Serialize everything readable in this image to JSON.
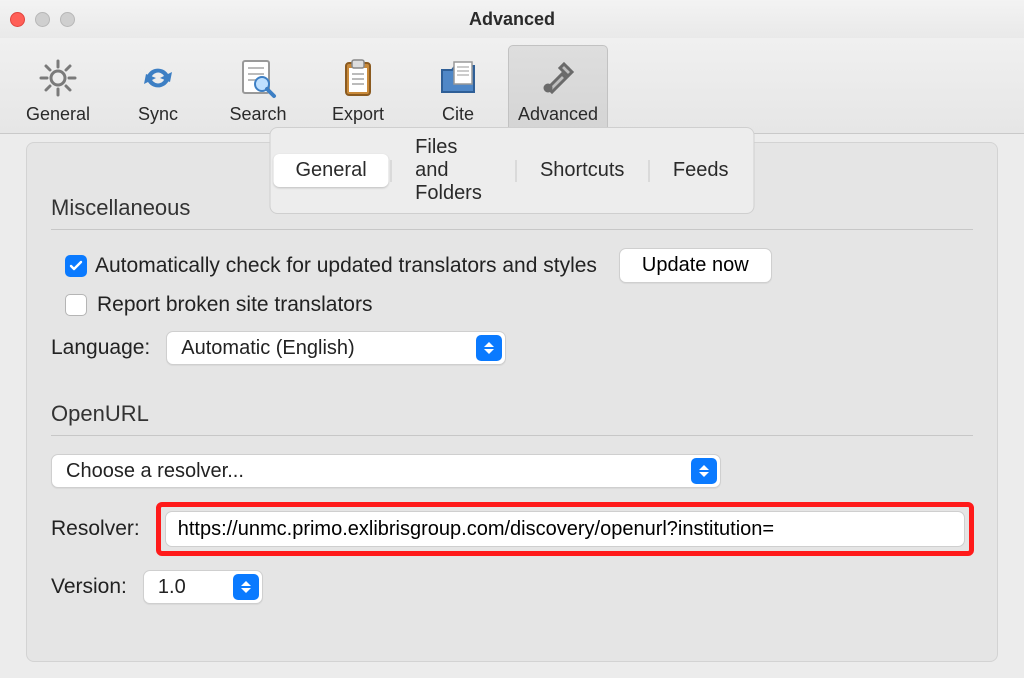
{
  "window": {
    "title": "Advanced"
  },
  "toolbar": {
    "items": [
      {
        "id": "general",
        "label": "General"
      },
      {
        "id": "sync",
        "label": "Sync"
      },
      {
        "id": "search",
        "label": "Search"
      },
      {
        "id": "export",
        "label": "Export"
      },
      {
        "id": "cite",
        "label": "Cite"
      },
      {
        "id": "advanced",
        "label": "Advanced"
      }
    ],
    "selected": "advanced"
  },
  "subtabs": {
    "items": [
      "General",
      "Files and Folders",
      "Shortcuts",
      "Feeds"
    ],
    "active": 0
  },
  "sections": {
    "misc": {
      "header": "Miscellaneous",
      "auto_check": {
        "checked": true,
        "label": "Automatically check for updated translators and styles",
        "button": "Update now"
      },
      "report_broken": {
        "checked": false,
        "label": "Report broken site translators"
      },
      "language": {
        "label": "Language:",
        "value": "Automatic (English)"
      }
    },
    "openurl": {
      "header": "OpenURL",
      "resolver_picker": {
        "value": "Choose a resolver..."
      },
      "resolver": {
        "label": "Resolver:",
        "value": "https://unmc.primo.exlibrisgroup.com/discovery/openurl?institution="
      },
      "version": {
        "label": "Version:",
        "value": "1.0"
      }
    }
  }
}
